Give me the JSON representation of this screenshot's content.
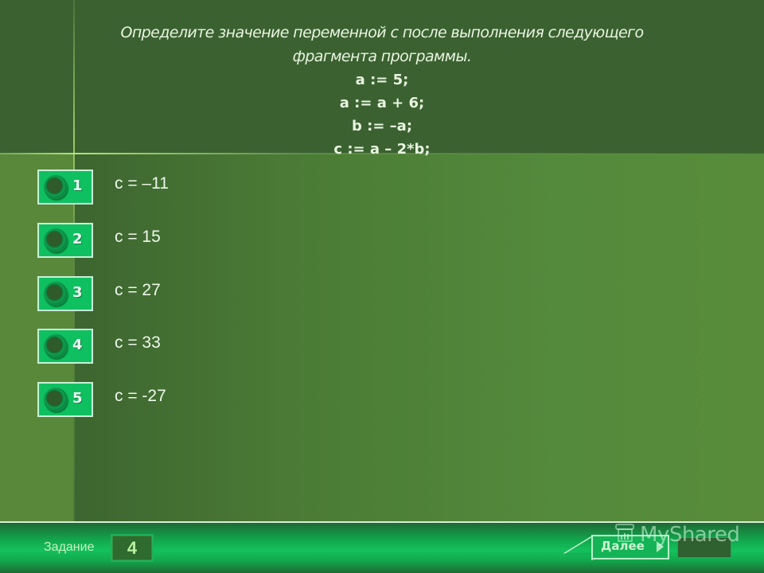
{
  "question": {
    "text_line1": "Определите значение переменной с после выполнения следующего",
    "text_line2": "фрагмента программы.",
    "code": [
      "a := 5;",
      "a := a + 6;",
      "b := –a;",
      "c := a – 2*b;"
    ]
  },
  "answers": [
    {
      "number": "1",
      "text": "c = –11"
    },
    {
      "number": "2",
      "text": "c = 15"
    },
    {
      "number": "3",
      "text": "c = 27"
    },
    {
      "number": "4",
      "text": "c = 33"
    },
    {
      "number": "5",
      "text": "c = -27"
    }
  ],
  "footer": {
    "task_label": "Задание",
    "task_number": "4",
    "next_label": "Далее",
    "watermark": "MyShared"
  },
  "colors": {
    "header_bg": "#3b6131",
    "answer_box": "#0fc060",
    "bottom_bar": "#14c15c"
  }
}
